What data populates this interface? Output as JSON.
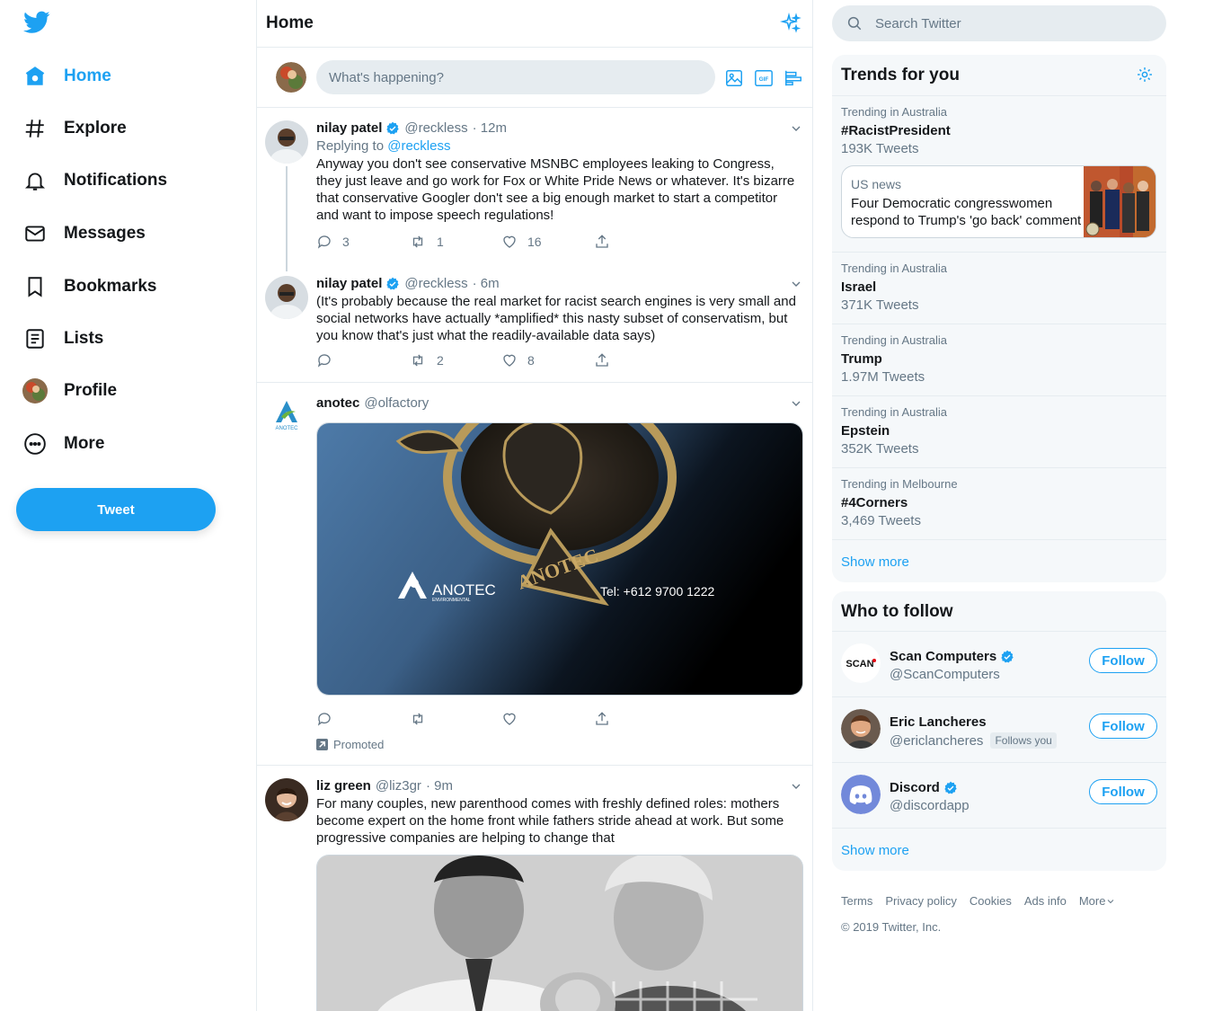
{
  "nav": {
    "items": [
      {
        "label": "Home",
        "icon": "home-icon"
      },
      {
        "label": "Explore",
        "icon": "hashtag-icon"
      },
      {
        "label": "Notifications",
        "icon": "bell-icon"
      },
      {
        "label": "Messages",
        "icon": "envelope-icon"
      },
      {
        "label": "Bookmarks",
        "icon": "bookmark-icon"
      },
      {
        "label": "Lists",
        "icon": "list-icon"
      },
      {
        "label": "Profile",
        "icon": "avatar"
      },
      {
        "label": "More",
        "icon": "more-circle-icon"
      }
    ],
    "tweet_button": "Tweet"
  },
  "timeline": {
    "title": "Home",
    "composer_placeholder": "What's happening?",
    "tweets": [
      {
        "name": "nilay patel",
        "handle": "@reckless",
        "time": "· 12m",
        "replying_label": "Replying to",
        "replying_to": "@reckless",
        "text": "Anyway you don't see conservative MSNBC employees leaking to Congress, they just leave and go work for Fox or White Pride News or whatever. It's bizarre that conservative Googler don't see a big enough market to start a competitor and want to impose speech regulations!",
        "replies": "3",
        "retweets": "1",
        "likes": "16"
      },
      {
        "name": "nilay patel",
        "handle": "@reckless",
        "time": "· 6m",
        "text": "(It's probably because the real market for racist search engines is very small and social networks have actually *amplified* this nasty subset of conservatism, but you know that's just what the readily-available data says)",
        "retweets": "2",
        "likes": "8"
      },
      {
        "name": "anotec",
        "handle": "@olfactory",
        "image_brand": "ANOTEC",
        "image_brand_sub": "ENVIRONMENTAL",
        "image_phone": "Tel:  +612 9700 1222",
        "avatar_text": "ANOTEC",
        "promoted": "Promoted"
      },
      {
        "name": "liz green",
        "handle": "@liz3gr",
        "time": "· 9m",
        "text": "For many couples, new parenthood comes with freshly defined roles: mothers become expert on the home front while fathers stride ahead at work. But some progressive companies are helping to change that"
      }
    ]
  },
  "sidebar": {
    "search_placeholder": "Search Twitter",
    "trends_title": "Trends for you",
    "trends": [
      {
        "context": "Trending in Australia",
        "name": "#RacistPresident",
        "count": "193K Tweets"
      },
      {
        "context": "Trending in Australia",
        "name": "Israel",
        "count": "371K Tweets"
      },
      {
        "context": "Trending in Australia",
        "name": "Trump",
        "count": "1.97M Tweets"
      },
      {
        "context": "Trending in Australia",
        "name": "Epstein",
        "count": "352K Tweets"
      },
      {
        "context": "Trending in Melbourne",
        "name": "#4Corners",
        "count": "3,469 Tweets"
      }
    ],
    "news": {
      "category": "US news",
      "text": "Four Democratic congresswomen respond to Trump's 'go back' comment"
    },
    "show_more": "Show more",
    "who_title": "Who to follow",
    "follow": [
      {
        "name": "Scan Computers",
        "handle": "@ScanComputers",
        "avatar_text": "SCAN",
        "button": "Follow"
      },
      {
        "name": "Eric Lancheres",
        "handle": "@ericlancheres",
        "badge": "Follows you",
        "button": "Follow"
      },
      {
        "name": "Discord",
        "handle": "@discordapp",
        "button": "Follow"
      }
    ],
    "footer_links": [
      "Terms",
      "Privacy policy",
      "Cookies",
      "Ads info",
      "More"
    ],
    "copyright": "© 2019 Twitter, Inc."
  },
  "colors": {
    "accent": "#1da1f2",
    "secondary_text": "#657786",
    "border": "#e6ecf0",
    "panel_bg": "#f5f8fa"
  }
}
